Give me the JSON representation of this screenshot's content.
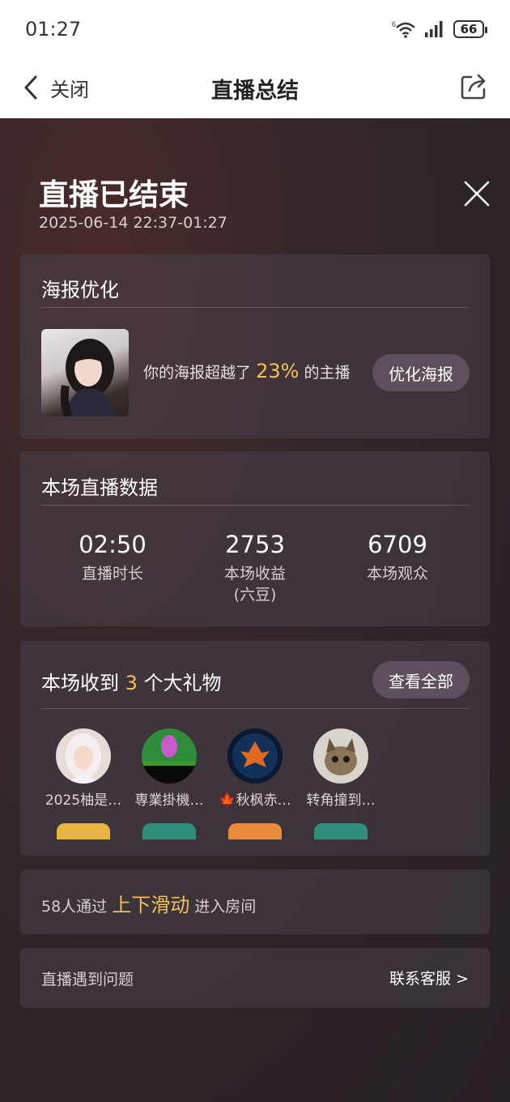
{
  "status_bar": {
    "time": "01:27",
    "battery": "66",
    "wifi_icon": "wifi-6-icon",
    "signal_icon": "signal-icon"
  },
  "nav": {
    "back_label": "关闭",
    "title": "直播总结",
    "share_icon": "share-icon"
  },
  "summary": {
    "title": "直播已结束",
    "time_range": "2025-06-14 22:37-01:27"
  },
  "poster": {
    "section_title": "海报优化",
    "text_prefix": "你的海报超越了",
    "percent": "23%",
    "text_suffix": "的主播",
    "button_label": "优化海报"
  },
  "stats": {
    "section_title": "本场直播数据",
    "items": [
      {
        "value": "02:50",
        "label": "直播时长"
      },
      {
        "value": "2753",
        "label": "本场收益\n(六豆)"
      },
      {
        "value": "6709",
        "label": "本场观众"
      }
    ]
  },
  "gifts": {
    "title_prefix": "本场收到",
    "count": "3",
    "title_suffix": "个大礼物",
    "view_all_label": "查看全部",
    "senders": [
      {
        "name": "2025柚是…",
        "badge_color": "#e8b640"
      },
      {
        "name": "専業掛機…",
        "badge_color": "#2f8f7a"
      },
      {
        "name": "🍁秋枫赤…",
        "badge_color": "#e88a38"
      },
      {
        "name": "转角撞到…",
        "badge_color": "#2f8f7a"
      }
    ]
  },
  "swipe": {
    "prefix": "58人通过",
    "highlight": "上下滑动",
    "suffix": "进入房间"
  },
  "help": {
    "text": "直播遇到问题",
    "link": "联系客服 >"
  },
  "colors": {
    "accent": "#f2c15c",
    "background": "#2a2226",
    "card": "#48404a",
    "pill": "#5d4f5c"
  }
}
